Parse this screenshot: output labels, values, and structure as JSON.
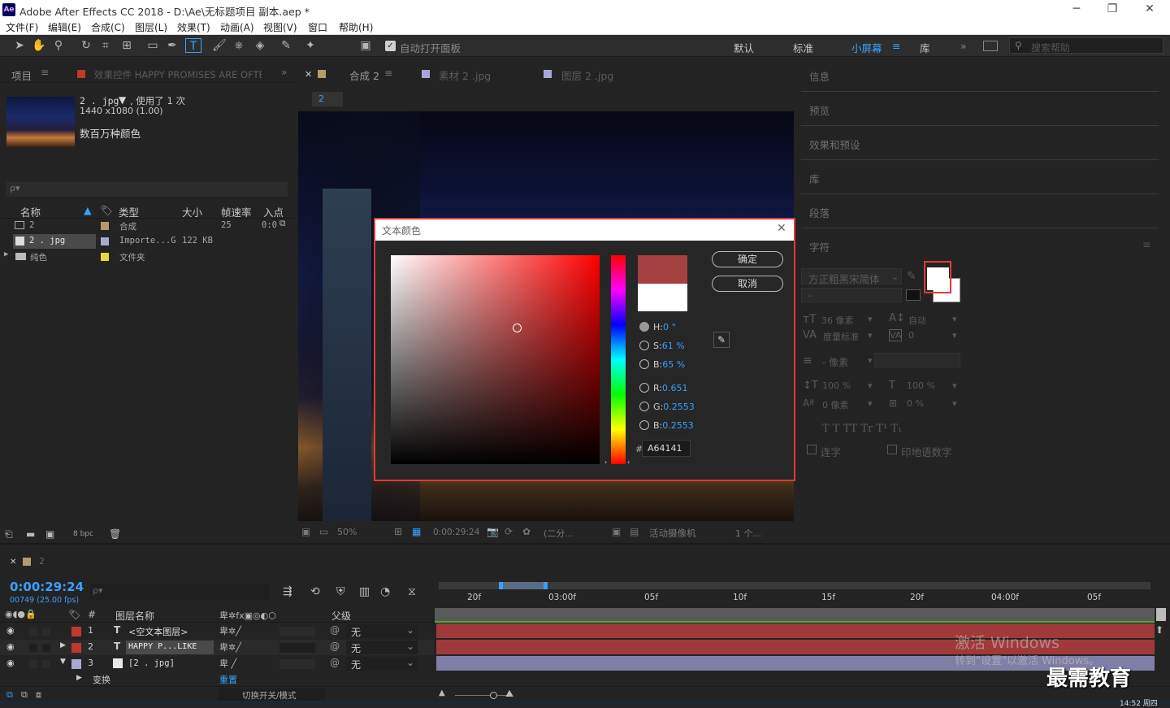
{
  "window": {
    "title": "Adobe After Effects CC 2018 - D:\\Ae\\无标题项目 副本.aep *",
    "logo_text": "Ae",
    "minimize_glyph": "─",
    "maximize_glyph": "❐",
    "close_glyph": "✕"
  },
  "menu": [
    "文件(F)",
    "编辑(E)",
    "合成(C)",
    "图层(L)",
    "效果(T)",
    "动画(A)",
    "视图(V)",
    "窗口",
    "帮助(H)"
  ],
  "toolbar": {
    "auto_open_label": "自动打开面板",
    "workspaces": [
      "默认",
      "标准",
      "小屏幕",
      "库"
    ],
    "active_workspace": "小屏幕",
    "search_placeholder": "搜索帮助",
    "more_glyph": "»"
  },
  "project_panel": {
    "tab_project": "项目",
    "tab_effects": "效果控件 HAPPY PROMISES ARE OFTEN",
    "selected_name": "2 . jpg",
    "used_text": ", 使用了 1 次",
    "dimensions": "1440 x1080 (1.00)",
    "color_depth_text": "数百万种颜色",
    "search_placeholder": "ρ▾",
    "columns": {
      "name": "名称",
      "type": "类型",
      "size": "大小",
      "fps": "帧速率",
      "in": "入点"
    },
    "rows": [
      {
        "name": "2",
        "label_color": "#b69a6e",
        "type": "合成",
        "size": "",
        "fps": "25",
        "in": "0:0"
      },
      {
        "name": "2 . jpg",
        "label_color": "#a8a8d6",
        "type": "Importe...G",
        "size": "122 KB",
        "fps": "",
        "in": ""
      },
      {
        "name": "纯色",
        "label_color": "#e8d83a",
        "type": "文件夹",
        "size": "",
        "fps": "",
        "in": ""
      }
    ],
    "bpc": "8 bpc"
  },
  "comp_panel": {
    "tabs": [
      {
        "label": "合成 2",
        "color": "#b69a6e"
      },
      {
        "label": "素材 2 .jpg",
        "color": "#a8a8d6"
      },
      {
        "label": "图层 2 .jpg",
        "color": "#a8a8d6"
      }
    ],
    "breadcrumb": "2",
    "zoom": "50%",
    "timecode": "0:00:29:24",
    "resolution": "(二分...",
    "camera": "活动摄像机",
    "views": "1 个..."
  },
  "right_panel": {
    "items": [
      "信息",
      "预览",
      "效果和预设",
      "库",
      "段落",
      "字符"
    ],
    "font_family": "方正粗黑宋简体",
    "font_style": "-",
    "font_size": "36 像素",
    "leading": "自动",
    "kerning": "度量标准",
    "tracking": "0",
    "stroke": "- 像素",
    "vscale": "100 %",
    "hscale": "100 %",
    "baseline": "0 像素",
    "tsume": "0 %",
    "styles_text": "T  T   TT Tr  T¹  T₁",
    "ligatures": "连字",
    "hindi_digits": "印地语数字"
  },
  "color_dialog": {
    "title": "文本颜色",
    "ok": "确定",
    "cancel": "取消",
    "new_color": "#a64141",
    "old_color": "#ffffff",
    "hue_color": "#ff0000",
    "h_label": "H:",
    "h_value": "0 °",
    "s_label": "S:",
    "s_value": "61 %",
    "b_label": "B:",
    "b_value": "65 %",
    "r_label": "R:",
    "r_value": "0.651",
    "g_label": "G:",
    "g_value": "0.2553",
    "bl_label": "B:",
    "bl_value": "0.2553",
    "hex_label": "#",
    "hex": "A64141"
  },
  "timeline": {
    "tab": "2",
    "timecode": "0:00:29:24",
    "frame_info": "00749 (25.00 fps)",
    "search_placeholder": "ρ▾",
    "col_layer_name": "图层名称",
    "col_parent": "父级",
    "ruler": [
      "20f",
      "03:00f",
      "05f",
      "10f",
      "15f",
      "20f",
      "04:00f",
      "05f"
    ],
    "layers": [
      {
        "num": "1",
        "type": "T",
        "name": "<空文本图层>",
        "color": "#c0392b",
        "parent": "无"
      },
      {
        "num": "2",
        "type": "T",
        "name": "HAPPY P...LIKE",
        "color": "#c0392b",
        "parent": "无"
      },
      {
        "num": "3",
        "type": "img",
        "name": "[2 . jpg]",
        "color": "#a8a8d6",
        "parent": "无"
      }
    ],
    "sub_item": "变换",
    "reset": "重置",
    "switch_modes": "切换开关/模式"
  },
  "watermark": {
    "line1": "激活 Windows",
    "line2": "转到\"设置\"以激活 Windows。",
    "brand": "最需教育"
  },
  "taskbar_time": "14:52 周四"
}
